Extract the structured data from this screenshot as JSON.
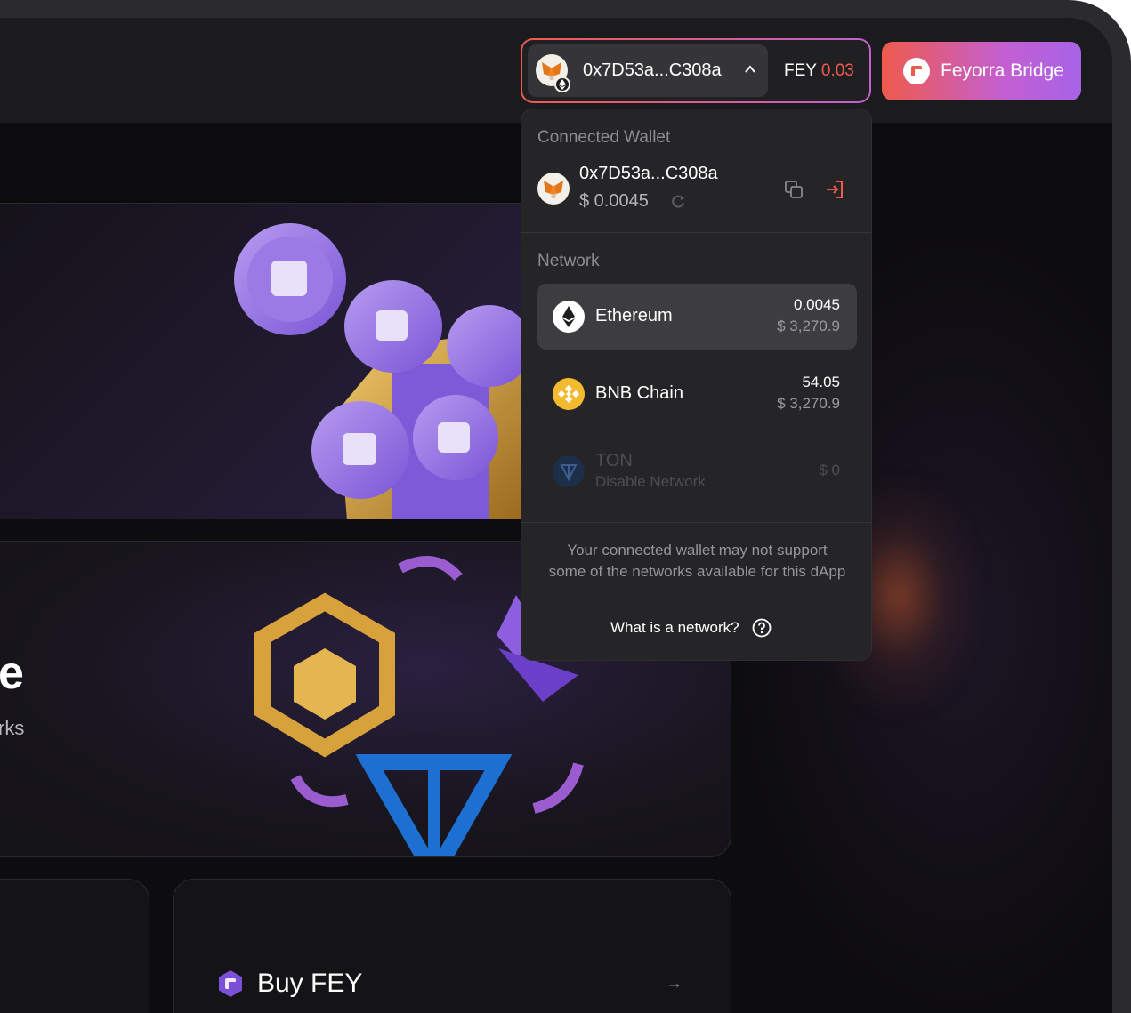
{
  "header": {
    "wallet_address": "0x7D53a...C308a",
    "token_symbol": "FEY",
    "token_balance": "0.03",
    "bridge_button_label": "Feyorra Bridge"
  },
  "dropdown": {
    "connected_wallet_title": "Connected Wallet",
    "wallet_address": "0x7D53a...C308a",
    "wallet_balance": "$ 0.0045",
    "network_title": "Network",
    "networks": [
      {
        "name": "Ethereum",
        "amount": "0.0045",
        "usd": "$ 3,270.9",
        "active": true
      },
      {
        "name": "BNB Chain",
        "amount": "54.05",
        "usd": "$ 3,270.9",
        "active": false
      },
      {
        "name": "TON",
        "sub": "Disable Network",
        "usd": "$ 0",
        "disabled": true
      }
    ],
    "note": "Your connected wallet may not support some of the networks available for this dApp",
    "help_link": "What is a network?"
  },
  "content": {
    "swap_title_fragment": "e",
    "swap_subtitle_fragment": "rks",
    "buy_card_label": "Buy FEY"
  },
  "colors": {
    "accent_red": "#f05a4f",
    "accent_purple": "#c45fd0",
    "bnb_yellow": "#f3ba2f",
    "ton_blue": "#1d6fd1"
  },
  "icons": [
    "metamask-icon",
    "ethereum-icon",
    "chevron-up-icon",
    "feyorra-logo-icon",
    "copy-icon",
    "logout-icon",
    "refresh-icon",
    "bnb-icon",
    "ton-icon",
    "help-icon",
    "arrow-right-icon"
  ]
}
